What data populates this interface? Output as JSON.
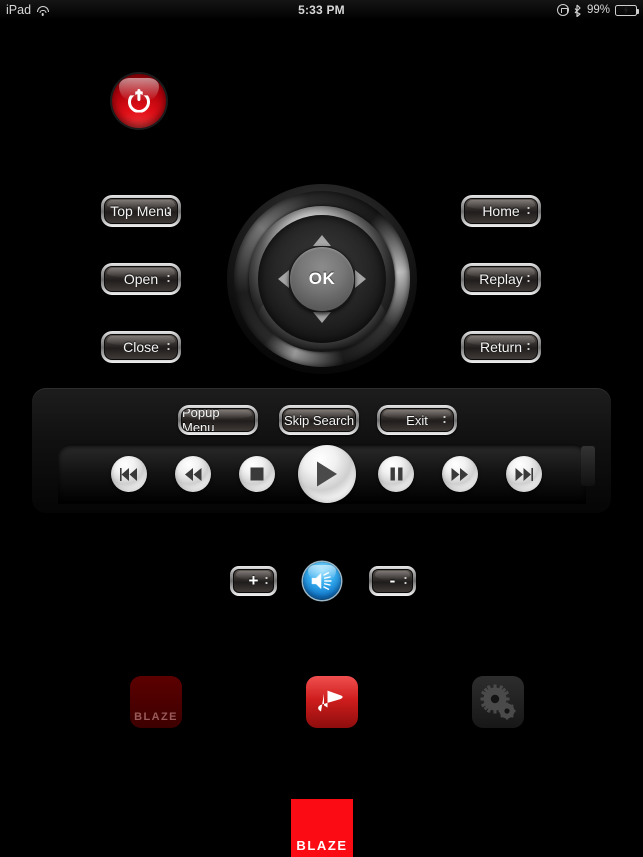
{
  "status_bar": {
    "device": "iPad",
    "wifi_icon": "wifi-icon",
    "time": "5:33 PM",
    "rotation_lock_icon": "rotation-lock-icon",
    "bluetooth_icon": "bluetooth-icon",
    "battery_percent": "99%",
    "battery_icon": "battery-charging-icon"
  },
  "power": {
    "label": "Power",
    "icon": "power-icon",
    "color": "#e10f17"
  },
  "left_buttons": [
    {
      "label": "Top Menu",
      "name": "top-menu-button"
    },
    {
      "label": "Open",
      "name": "open-button"
    },
    {
      "label": "Close",
      "name": "close-button"
    }
  ],
  "right_buttons": [
    {
      "label": "Home",
      "name": "home-button"
    },
    {
      "label": "Replay",
      "name": "replay-button"
    },
    {
      "label": "Return",
      "name": "return-button"
    }
  ],
  "dpad": {
    "ok_label": "OK",
    "up_icon": "arrow-up-icon",
    "down_icon": "arrow-down-icon",
    "left_icon": "arrow-left-icon",
    "right_icon": "arrow-right-icon"
  },
  "menu_row": [
    {
      "label": "Popup Menu",
      "name": "popup-menu-button"
    },
    {
      "label": "Skip Search",
      "name": "skip-search-button"
    },
    {
      "label": "Exit",
      "name": "exit-button"
    }
  ],
  "transport": [
    {
      "name": "previous-track-button",
      "icon": "skip-backward-icon"
    },
    {
      "name": "rewind-button",
      "icon": "rewind-icon"
    },
    {
      "name": "stop-button",
      "icon": "stop-icon"
    },
    {
      "name": "play-button",
      "icon": "play-icon"
    },
    {
      "name": "pause-button",
      "icon": "pause-icon"
    },
    {
      "name": "fast-forward-button",
      "icon": "fast-forward-icon"
    },
    {
      "name": "next-track-button",
      "icon": "skip-forward-icon"
    }
  ],
  "volume": {
    "up_label": "+",
    "down_label": "-",
    "mute_icon": "speaker-icon",
    "mute_color": "#2a9fe4"
  },
  "app_icons": [
    {
      "name": "blaze-app-icon-dim",
      "label": "BLAZE",
      "icon": "blaze-icon"
    },
    {
      "name": "bluray-app-icon",
      "label": "",
      "icon": "bluray-disc-icon"
    },
    {
      "name": "settings-app-icon",
      "label": "",
      "icon": "gear-icon"
    }
  ],
  "brand": {
    "label": "BLAZE",
    "color": "#fb0b14"
  }
}
